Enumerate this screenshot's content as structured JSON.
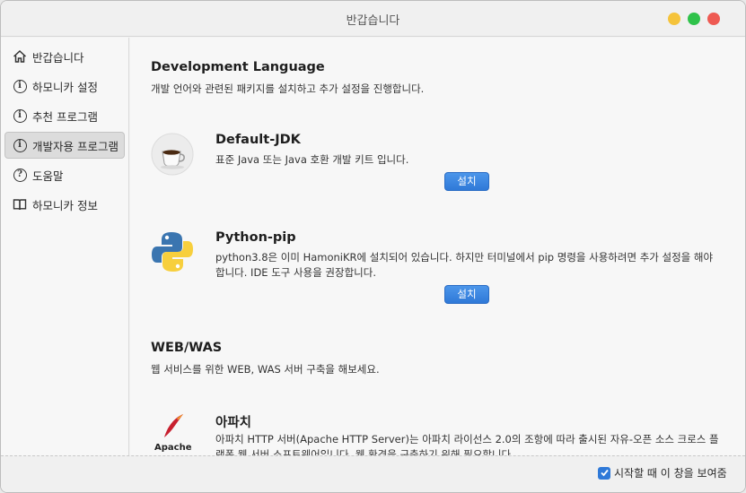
{
  "window": {
    "title": "반갑습니다"
  },
  "sidebar": {
    "items": [
      {
        "label": "반갑습니다",
        "icon": "home-icon"
      },
      {
        "label": "하모니카 설정",
        "icon": "info-icon"
      },
      {
        "label": "추천 프로그램",
        "icon": "info-icon"
      },
      {
        "label": "개발자용 프로그램",
        "icon": "info-icon",
        "active": true
      },
      {
        "label": "도움말",
        "icon": "help-icon"
      },
      {
        "label": "하모니카 정보",
        "icon": "book-icon"
      }
    ]
  },
  "main": {
    "sections": [
      {
        "title": "Development Language",
        "description": "개발 언어와 관련된 패키지를 설치하고 추가 설정을 진행합니다.",
        "apps": [
          {
            "name": "Default-JDK",
            "description": "표준 Java 또는 Java 호환 개발 키트 입니다.",
            "button": "설치",
            "icon": "java-cup-icon"
          },
          {
            "name": "Python-pip",
            "description": "python3.8은 이미 HamoniKR에 설치되어 있습니다. 하지만 터미널에서 pip 명령을 사용하려면 추가 설정을 해야 합니다. IDE 도구 사용을 권장합니다.",
            "button": "설치",
            "icon": "python-icon"
          }
        ]
      },
      {
        "title": "WEB/WAS",
        "description": "웹 서비스를 위한 WEB, WAS 서버 구축을 해보세요.",
        "apps": [
          {
            "name": "아파치",
            "description": "아파치 HTTP 서버(Apache HTTP Server)는 아파치 라이선스 2.0의 조항에 따라 출시된 자유-오픈 소스 크로스 플랫폼 웹 서버 소프트웨어입니다. 웹 환경을 구축하기 위해 필요합니다.",
            "icon": "apache-feather-icon",
            "logo_text": "Apache"
          }
        ]
      }
    ]
  },
  "footer": {
    "show_on_startup_label": "시작할 때 이 창을 보여줌",
    "show_on_startup_checked": true
  }
}
